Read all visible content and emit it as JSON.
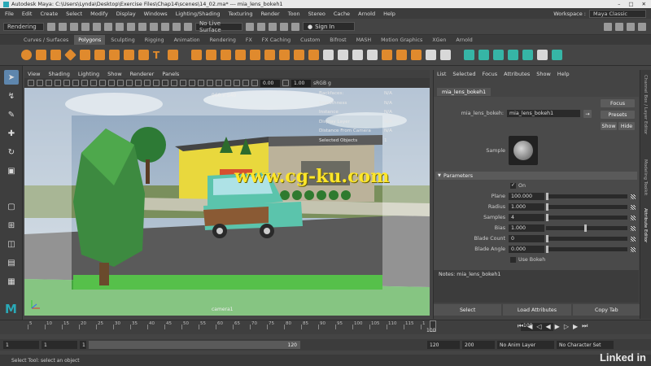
{
  "title": "Autodesk Maya: C:\\Users\\Lynda\\Desktop\\Exercise Files\\Chap14\\scenes\\14_02.ma* --- mia_lens_bokeh1",
  "menubar": [
    "File",
    "Edit",
    "Create",
    "Select",
    "Modify",
    "Display",
    "Windows",
    "Lighting/Shading",
    "Texturing",
    "Render",
    "Toon",
    "Stereo",
    "Cache",
    "Arnold",
    "Help"
  ],
  "workspace_label": "Workspace :",
  "workspace_value": "Maya Classic",
  "status": {
    "mode": "Rendering",
    "live_surface": "No Live Surface",
    "sign_in": "Sign In"
  },
  "shelf_tabs": [
    "Curves / Surfaces",
    "Polygons",
    "Sculpting",
    "Rigging",
    "Animation",
    "Rendering",
    "FX",
    "FX Caching",
    "Custom",
    "Bifrost",
    "MASH",
    "Motion Graphics",
    "XGen",
    "Arnold"
  ],
  "shelf_active": "Polygons",
  "viewport": {
    "menu": [
      "View",
      "Shading",
      "Lighting",
      "Show",
      "Renderer",
      "Panels"
    ],
    "exposure": "0.00",
    "gamma": "1.00",
    "colorspace": "sRGB g",
    "resolution": "960 x 540",
    "camera": "camera1",
    "hud_labels": [
      "Backfaces:",
      "Smoothness",
      "Instance",
      "Display Layer",
      "Distance From Camera",
      "Selected Objects"
    ],
    "hud_values": [
      "N/A",
      "N/A",
      "N/A",
      "N/A",
      "N/A",
      "1"
    ],
    "watermark": "www.cg-ku.com"
  },
  "ae": {
    "menu": [
      "List",
      "Selected",
      "Focus",
      "Attributes",
      "Show",
      "Help"
    ],
    "tab": "mia_lens_bokeh1",
    "node_label": "mia_lens_bokeh:",
    "node_value": "mia_lens_bokeh1",
    "focus": "Focus",
    "presets": "Presets",
    "show": "Show",
    "hide": "Hide",
    "sample_label": "Sample",
    "parameters": "Parameters",
    "on_label": "On",
    "params": [
      {
        "label": "Plane",
        "value": "100.000",
        "fraction": 0.0
      },
      {
        "label": "Radius",
        "value": "1.000",
        "fraction": 0.0
      },
      {
        "label": "Samples",
        "value": "4",
        "fraction": 0.0
      },
      {
        "label": "Bias",
        "value": "1.000",
        "fraction": 0.48
      },
      {
        "label": "Blade Count",
        "value": "0",
        "fraction": 0.0
      },
      {
        "label": "Blade Angle",
        "value": "0.000",
        "fraction": 0.0
      }
    ],
    "use_bokeh": "Use Bokeh",
    "notes": "Notes: mia_lens_bokeh1",
    "buttons": [
      "Select",
      "Load Attributes",
      "Copy Tab"
    ]
  },
  "side_tabs": [
    "Channel Box / Layer Editor",
    "Modeling Toolkit",
    "Attribute Editor"
  ],
  "timeline": {
    "ticks": [
      "5",
      "10",
      "15",
      "20",
      "25",
      "30",
      "35",
      "40",
      "45",
      "50",
      "55",
      "60",
      "65",
      "70",
      "75",
      "80",
      "85",
      "90",
      "95",
      "100",
      "105",
      "110",
      "115",
      "1"
    ],
    "current_frame": "100",
    "end_frame": "100"
  },
  "range": {
    "start": "1",
    "start2": "1",
    "range_start": "1",
    "range_end": "120",
    "anim_end": "120",
    "max": "200",
    "anim_layer": "No Anim Layer",
    "char_set": "No Character Set"
  },
  "help": "Select Tool: select an object",
  "brand": "Linked in"
}
